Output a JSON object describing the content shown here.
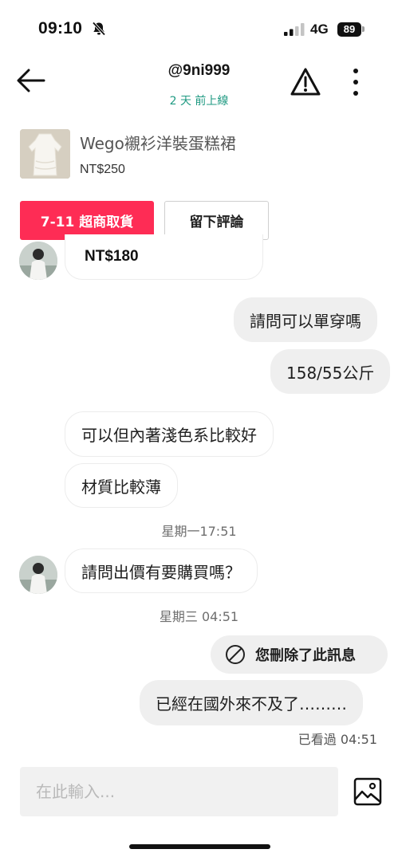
{
  "status_bar": {
    "time": "09:10",
    "network": "4G",
    "battery": "89",
    "icons": [
      "bell-off-icon",
      "signal-icon",
      "battery-icon"
    ]
  },
  "header": {
    "username": "@9ni999",
    "online_status": "2 天 前上線",
    "icons": [
      "back-arrow-icon",
      "warning-icon",
      "more-icon"
    ]
  },
  "product": {
    "title": "Wego襯衫洋裝蛋糕裙",
    "price": "NT$250"
  },
  "actions": {
    "pickup_label": "7-11 超商取貨",
    "review_label": "留下評論"
  },
  "messages": {
    "price_offer": "NT$180",
    "out_1": "請問可以單穿嗎",
    "out_2": "158/55公斤",
    "in_1": "可以但內著淺色系比較好",
    "in_2": "材質比較薄",
    "ts_1": "星期一17:51",
    "in_3": "請問出價有要購買嗎？",
    "ts_2": "星期三 04:51",
    "deleted": "您刪除了此訊息",
    "out_3": "已經在國外來不及了………",
    "seen": "已看過 04:51"
  },
  "input": {
    "placeholder": "在此輸入..."
  },
  "colors": {
    "accent": "#fe2c55",
    "online": "#1f9a82",
    "bubble_out": "#efefef"
  }
}
